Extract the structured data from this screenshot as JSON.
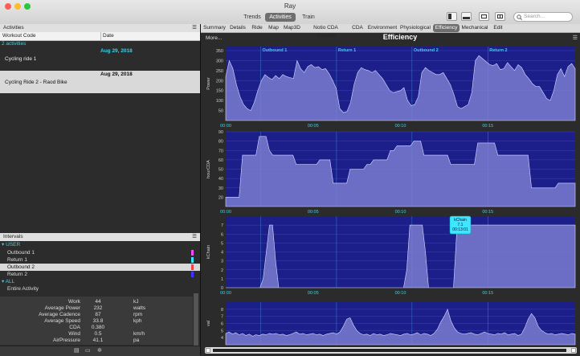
{
  "window": {
    "title": "Ray"
  },
  "toolbar": {
    "views": [
      "Trends",
      "Activities",
      "Train"
    ],
    "active_view": "Activities",
    "search_placeholder": "Search..."
  },
  "activities_panel": {
    "title": "Activities",
    "columns": [
      "Workout Code",
      "Date"
    ],
    "group_label": "2 activities",
    "rows": [
      {
        "date": "Aug 29, 2018",
        "name": "Cycling ride 1"
      },
      {
        "date": "Aug 29, 2018",
        "name": "Cycling Ride 2 - Raod Bike"
      }
    ]
  },
  "intervals_panel": {
    "title": "Intervals",
    "user_group": "USER",
    "user_items": [
      "Outbound 1",
      "Return 1",
      "Outbound 2",
      "Return 2"
    ],
    "all_group": "ALL",
    "all_items": [
      "Entire Activity"
    ],
    "metrics": [
      {
        "label": "Work",
        "value": "44",
        "unit": "kJ"
      },
      {
        "label": "Average Power",
        "value": "232",
        "unit": "watts"
      },
      {
        "label": "Average Cadence",
        "value": "87",
        "unit": "rpm"
      },
      {
        "label": "Average Speed",
        "value": "33.8",
        "unit": "kph"
      },
      {
        "label": "CDA",
        "value": "0.380",
        "unit": ""
      },
      {
        "label": "Wind",
        "value": "0.5",
        "unit": "km/h"
      },
      {
        "label": "AirPressure",
        "value": "41.1",
        "unit": "pa"
      }
    ],
    "swatch_colors": [
      "#ff44ff",
      "#44e0ff",
      "#ff3b3b",
      "#3b3bff"
    ]
  },
  "tabs": {
    "items": [
      "Summary",
      "Details",
      "Ride",
      "Map",
      "Map3D",
      "Notio CDA Analysis",
      "CDA",
      "Environment",
      "Physiological",
      "Efficiency",
      "Mechanical",
      "Edit"
    ],
    "active": "Efficiency"
  },
  "chart_header": {
    "more_label": "More...",
    "title": "Efficiency"
  },
  "colors": {
    "plot_bg": "#1c1f8a",
    "area_fill": "#7a7ccf",
    "accent": "#39d3e8",
    "interval_label": "#39d3e8"
  },
  "chart_data": [
    {
      "type": "area",
      "ylabel": "Power",
      "ylim": [
        0,
        370
      ],
      "yticks": [
        50,
        100,
        150,
        200,
        250,
        300,
        350
      ],
      "xticks": [
        "00:00",
        "00:05",
        "00:10",
        "00:15"
      ],
      "interval_markers": [
        "Outbound 1",
        "Return 1",
        "Outbound 2",
        "Return 2"
      ],
      "y": [
        220,
        300,
        260,
        180,
        120,
        80,
        60,
        50,
        90,
        150,
        200,
        230,
        215,
        205,
        225,
        210,
        230,
        220,
        215,
        210,
        300,
        260,
        240,
        270,
        280,
        265,
        270,
        255,
        260,
        235,
        200,
        160,
        60,
        40,
        45,
        90,
        180,
        240,
        265,
        255,
        250,
        240,
        250,
        230,
        210,
        180,
        150,
        140,
        145,
        150,
        165,
        100,
        75,
        80,
        120,
        240,
        265,
        250,
        240,
        230,
        230,
        240,
        210,
        180,
        130,
        70,
        60,
        70,
        80,
        140,
        300,
        325,
        310,
        295,
        280,
        275,
        285,
        255,
        260,
        290,
        270,
        250,
        280,
        265,
        230,
        210,
        185,
        170,
        170,
        140,
        110,
        100,
        150,
        230,
        260,
        220,
        270,
        285,
        260
      ]
    },
    {
      "type": "area",
      "ylabel": "hourCDA",
      "ylim": [
        10,
        90
      ],
      "yticks": [
        20,
        30,
        40,
        50,
        60,
        70,
        80,
        90
      ],
      "xticks": [
        "00:00",
        "00:05",
        "00:10",
        "00:15"
      ],
      "y": [
        20,
        20,
        20,
        20,
        20,
        65,
        65,
        65,
        65,
        65,
        85,
        85,
        85,
        70,
        65,
        65,
        65,
        65,
        65,
        65,
        65,
        55,
        55,
        55,
        55,
        55,
        55,
        55,
        60,
        60,
        60,
        60,
        35,
        35,
        35,
        35,
        35,
        50,
        50,
        50,
        50,
        50,
        55,
        55,
        60,
        60,
        60,
        60,
        60,
        70,
        70,
        75,
        75,
        75,
        75,
        75,
        80,
        80,
        80,
        65,
        65,
        65,
        65,
        65,
        65,
        65,
        65,
        55,
        55,
        55,
        55,
        55,
        55,
        55,
        55,
        78,
        78,
        78,
        78,
        78,
        78,
        65,
        65,
        65,
        65,
        65,
        65,
        65,
        65,
        65,
        65,
        30,
        30,
        30,
        30,
        30,
        30,
        30,
        30,
        35,
        35,
        35,
        35,
        35,
        35
      ]
    },
    {
      "type": "area",
      "ylabel": "kChain",
      "ylim": [
        0,
        8
      ],
      "yticks": [
        0,
        1,
        2,
        3,
        4,
        5,
        6,
        7
      ],
      "xticks": [
        "00:00",
        "00:05",
        "00:10",
        "00:15"
      ],
      "tooltip": {
        "series": "kChain",
        "value": "7.1",
        "time": "00:13:01"
      },
      "y": [
        0,
        0,
        0,
        0,
        0,
        0,
        0,
        0,
        0,
        0,
        0,
        0,
        1,
        4,
        7,
        7,
        3,
        0,
        0,
        0,
        0,
        0,
        0,
        0,
        0,
        0,
        0,
        0,
        0,
        0,
        0,
        0,
        0,
        0,
        0,
        0,
        0,
        0,
        0,
        0,
        0,
        0,
        0,
        0,
        0,
        0,
        0,
        0,
        0,
        0,
        0,
        0,
        0,
        0,
        0,
        0,
        0,
        0,
        2,
        7,
        7,
        7,
        7,
        7,
        4,
        0,
        0,
        0,
        0,
        0,
        0,
        0,
        0,
        0,
        6,
        7,
        7,
        7,
        7,
        7,
        7,
        7,
        7,
        7,
        7,
        7,
        7,
        7,
        7,
        7,
        7,
        7,
        7,
        7,
        7,
        7,
        7,
        7,
        7,
        7,
        7,
        7,
        7,
        7,
        7,
        7,
        7,
        7,
        7,
        7,
        7,
        7,
        7
      ]
    },
    {
      "type": "area",
      "ylabel": "val",
      "ylim": [
        3,
        9
      ],
      "yticks": [
        4,
        5,
        6,
        7,
        8
      ],
      "y": [
        4.6,
        4.8,
        4.5,
        4.7,
        4.4,
        4.6,
        4.3,
        4.5,
        4.2,
        4.4,
        4.3,
        4.5,
        4.4,
        4.6,
        4.5,
        4.6,
        4.4,
        4.5,
        4.3,
        4.4,
        4.6,
        4.8,
        4.5,
        4.6,
        4.4,
        4.5,
        4.6,
        4.4,
        4.5,
        4.3,
        4.5,
        4.6,
        4.7,
        4.5,
        4.8,
        5.6,
        6.6,
        6.8,
        5.8,
        5.0,
        4.6,
        4.4,
        4.5,
        4.3,
        4.6,
        4.4,
        4.5,
        4.3,
        4.4,
        4.6,
        4.5,
        4.4,
        4.3,
        4.5,
        4.6,
        4.4,
        4.5,
        4.7,
        4.4,
        4.6,
        4.5,
        4.3,
        4.6,
        5.2,
        6.2,
        7.0,
        8.0,
        6.4,
        5.4,
        4.8,
        4.6,
        4.5,
        4.6,
        4.7,
        4.5,
        4.4,
        4.6,
        4.8,
        4.6,
        4.5,
        4.4,
        4.6,
        4.5,
        4.7,
        4.4,
        4.5,
        4.6,
        4.3,
        4.5,
        5.4,
        6.6,
        7.4,
        6.8,
        5.6,
        5.0,
        4.7,
        4.5,
        4.6,
        4.4,
        4.5,
        4.6,
        4.5,
        4.4,
        4.6,
        4.5
      ]
    }
  ]
}
